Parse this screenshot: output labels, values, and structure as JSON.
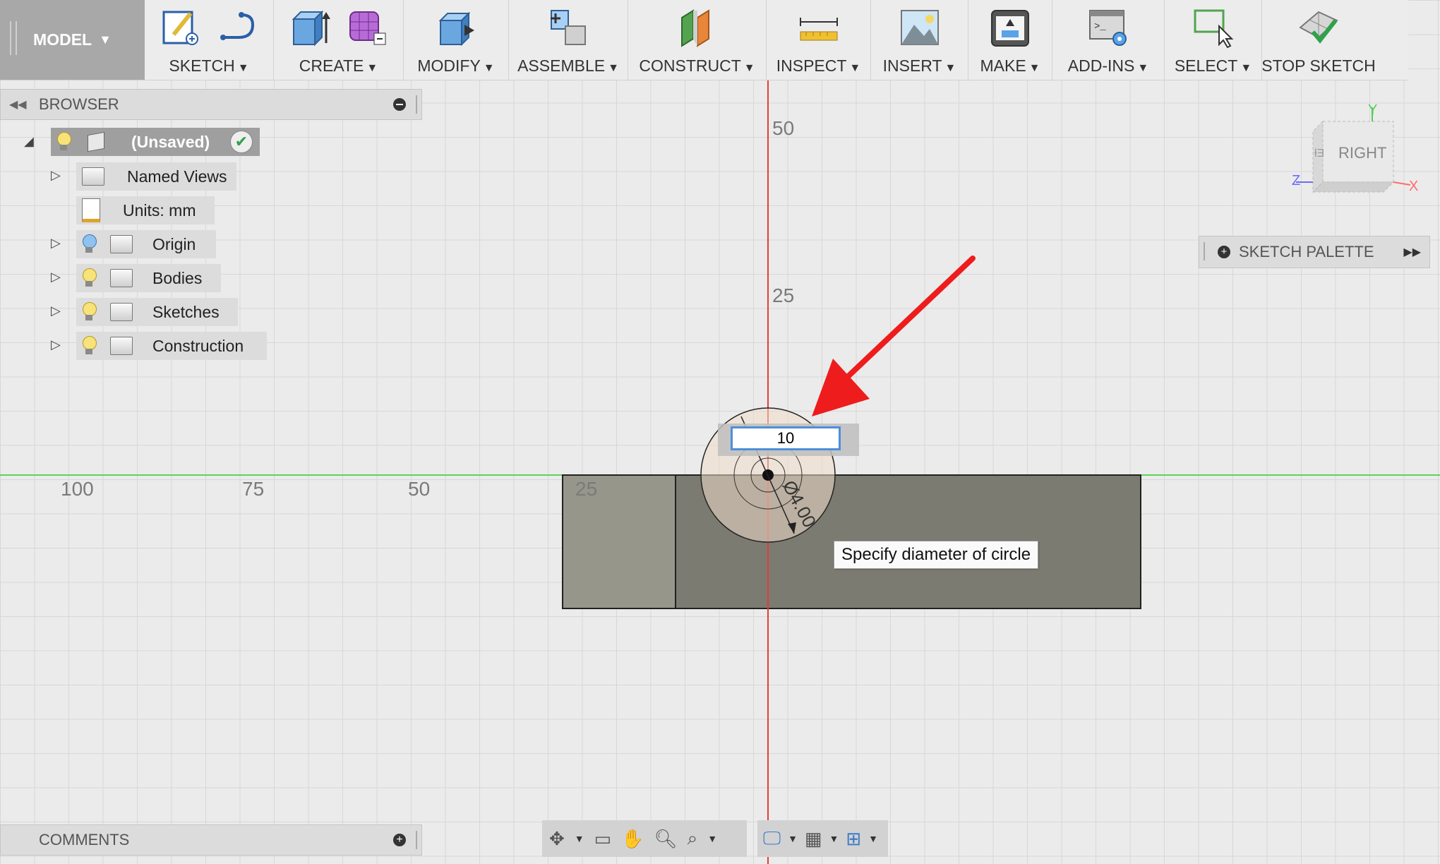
{
  "toolbar": {
    "model_label": "MODEL",
    "groups": {
      "sketch": "SKETCH",
      "create": "CREATE",
      "modify": "MODIFY",
      "assemble": "ASSEMBLE",
      "construct": "CONSTRUCT",
      "inspect": "INSPECT",
      "insert": "INSERT",
      "make": "MAKE",
      "addins": "ADD-INS",
      "select": "SELECT",
      "stop_sketch": "STOP SKETCH"
    },
    "caret": "▼"
  },
  "browser": {
    "title": "BROWSER",
    "root": "(Unsaved)",
    "items": {
      "named_views": "Named Views",
      "units": "Units: mm",
      "origin": "Origin",
      "bodies": "Bodies",
      "sketches": "Sketches",
      "construction": "Construction"
    }
  },
  "comments": {
    "title": "COMMENTS"
  },
  "sketch_palette": {
    "title": "SKETCH PALETTE"
  },
  "viewcube": {
    "face": "RIGHT",
    "z": "Z",
    "y": "Y",
    "x": "X"
  },
  "axis_labels": {
    "y50": "50",
    "y25": "25",
    "x100": "100",
    "x75": "75",
    "x50": "50",
    "x25": "25"
  },
  "dimension": {
    "input_value": "10",
    "dim_text": "Ø4.00"
  },
  "tooltip": "Specify diameter of circle",
  "colors": {
    "x_axis": "#5bd35b",
    "y_axis": "#e53a3a",
    "arrow": "#ee1c1c",
    "body": "#7a7a6e"
  }
}
